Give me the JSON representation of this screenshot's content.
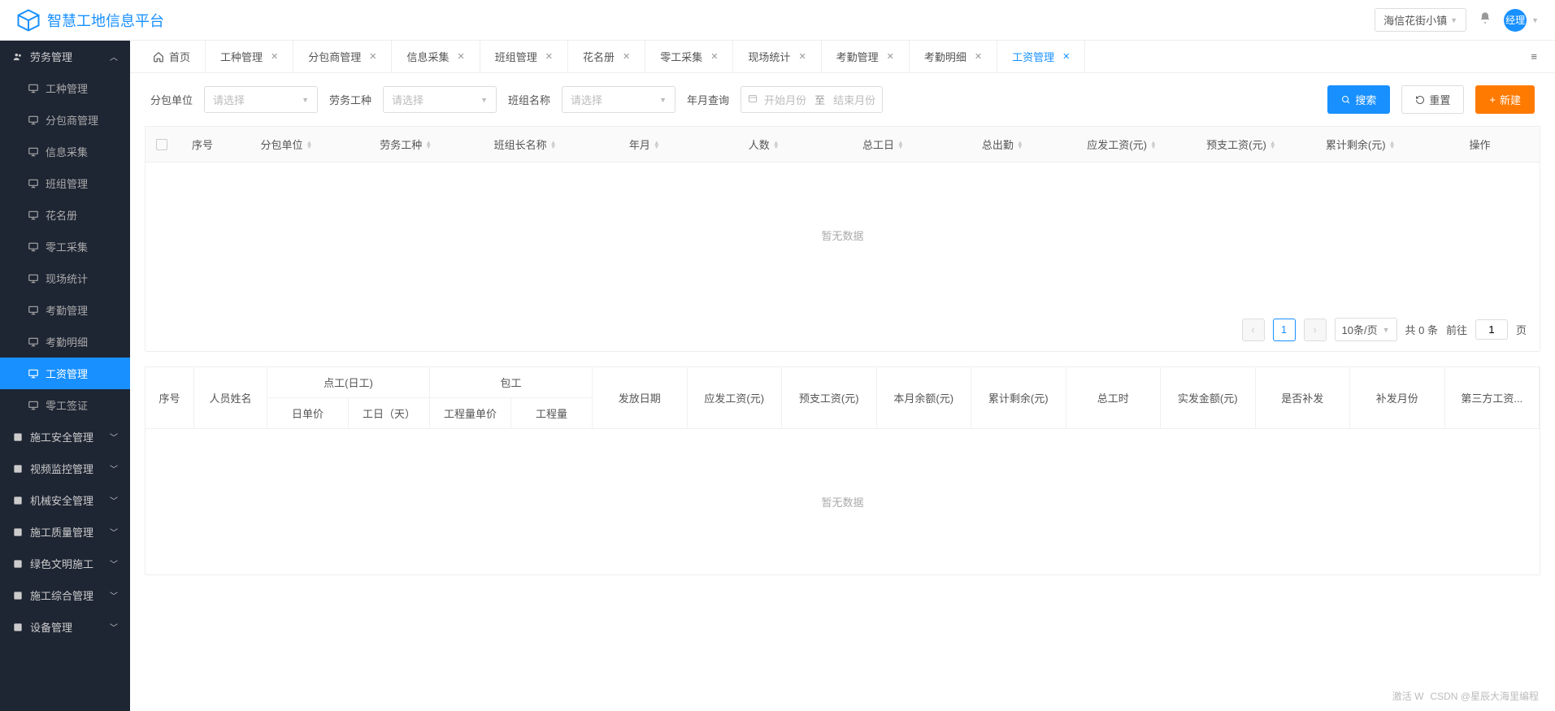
{
  "header": {
    "title": "智慧工地信息平台",
    "site": "海信花街小镇",
    "avatar_label": "经理"
  },
  "tabs": [
    {
      "label": "首页",
      "home": true
    },
    {
      "label": "工种管理"
    },
    {
      "label": "分包商管理"
    },
    {
      "label": "信息采集"
    },
    {
      "label": "班组管理"
    },
    {
      "label": "花名册"
    },
    {
      "label": "零工采集"
    },
    {
      "label": "现场统计"
    },
    {
      "label": "考勤管理"
    },
    {
      "label": "考勤明细"
    },
    {
      "label": "工资管理",
      "active": true
    }
  ],
  "sidebar": {
    "labor_group": "劳务管理",
    "items": [
      "工种管理",
      "分包商管理",
      "信息采集",
      "班组管理",
      "花名册",
      "零工采集",
      "现场统计",
      "考勤管理",
      "考勤明细",
      "工资管理",
      "零工签证"
    ],
    "active_index": 9,
    "other_groups": [
      "施工安全管理",
      "视频监控管理",
      "机械安全管理",
      "施工质量管理",
      "绿色文明施工",
      "施工综合管理",
      "设备管理"
    ]
  },
  "filters": {
    "sub_unit_label": "分包单位",
    "labor_type_label": "劳务工种",
    "team_name_label": "班组名称",
    "year_month_label": "年月查询",
    "placeholder_select": "请选择",
    "placeholder_start": "开始月份",
    "date_sep": "至",
    "placeholder_end": "结束月份",
    "btn_search": "搜索",
    "btn_reset": "重置",
    "btn_new": "新建"
  },
  "table1": {
    "cols": [
      "序号",
      "分包单位",
      "劳务工种",
      "班组长名称",
      "年月",
      "人数",
      "总工日",
      "总出勤",
      "应发工资(元)",
      "预支工资(元)",
      "累计剩余(元)",
      "操作"
    ],
    "empty": "暂无数据"
  },
  "pagination": {
    "page": "1",
    "page_size": "10条/页",
    "total_text": "共 0 条",
    "goto": "前往",
    "goto_val": "1",
    "unit": "页"
  },
  "table2": {
    "seq": "序号",
    "name": "人员姓名",
    "day_group": "点工(日工)",
    "day_price": "日单价",
    "day_count": "工日（天）",
    "piece_group": "包工",
    "piece_price": "工程量单价",
    "piece_qty": "工程量",
    "cols_right": [
      "发放日期",
      "应发工资(元)",
      "预支工资(元)",
      "本月余额(元)",
      "累计剩余(元)",
      "总工时",
      "实发金额(元)",
      "是否补发",
      "补发月份",
      "第三方工资..."
    ],
    "empty": "暂无数据"
  },
  "watermark": {
    "a": "激活 W",
    "b": "CSDN @星辰大海里编程"
  }
}
